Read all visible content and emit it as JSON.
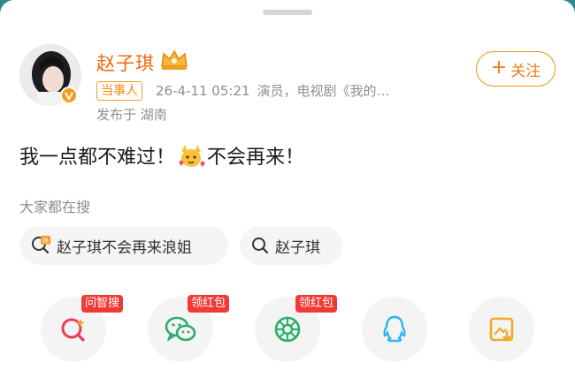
{
  "post": {
    "author": {
      "name": "赵子琪",
      "tag": "当事人",
      "time": "26-4-11 05:21",
      "role": "演员，电视剧《我的…",
      "location": "发布于 湖南"
    },
    "follow_label": "关注",
    "content_part1": "我一点都不难过！",
    "content_part2": "不会再来！"
  },
  "hot_search": {
    "title": "大家都在搜",
    "chips": [
      {
        "label": "赵子琪不会再来浪姐",
        "icon": "hot-search-icon"
      },
      {
        "label": "赵子琪",
        "icon": "search-icon"
      }
    ]
  },
  "share": {
    "items": [
      {
        "icon": "ai-search-icon",
        "badge": "问智搜",
        "color": "#f03a55"
      },
      {
        "icon": "wechat-icon",
        "badge": "领红包",
        "color": "#2aae67"
      },
      {
        "icon": "moments-icon",
        "badge": "领红包",
        "color": "#2aae67"
      },
      {
        "icon": "qq-icon",
        "badge": "",
        "color": "#2fb2f0"
      },
      {
        "icon": "save-image-icon",
        "badge": "",
        "color": "#f5a623"
      }
    ]
  },
  "colors": {
    "accent": "#f0690a",
    "badge": "#f03a36"
  }
}
